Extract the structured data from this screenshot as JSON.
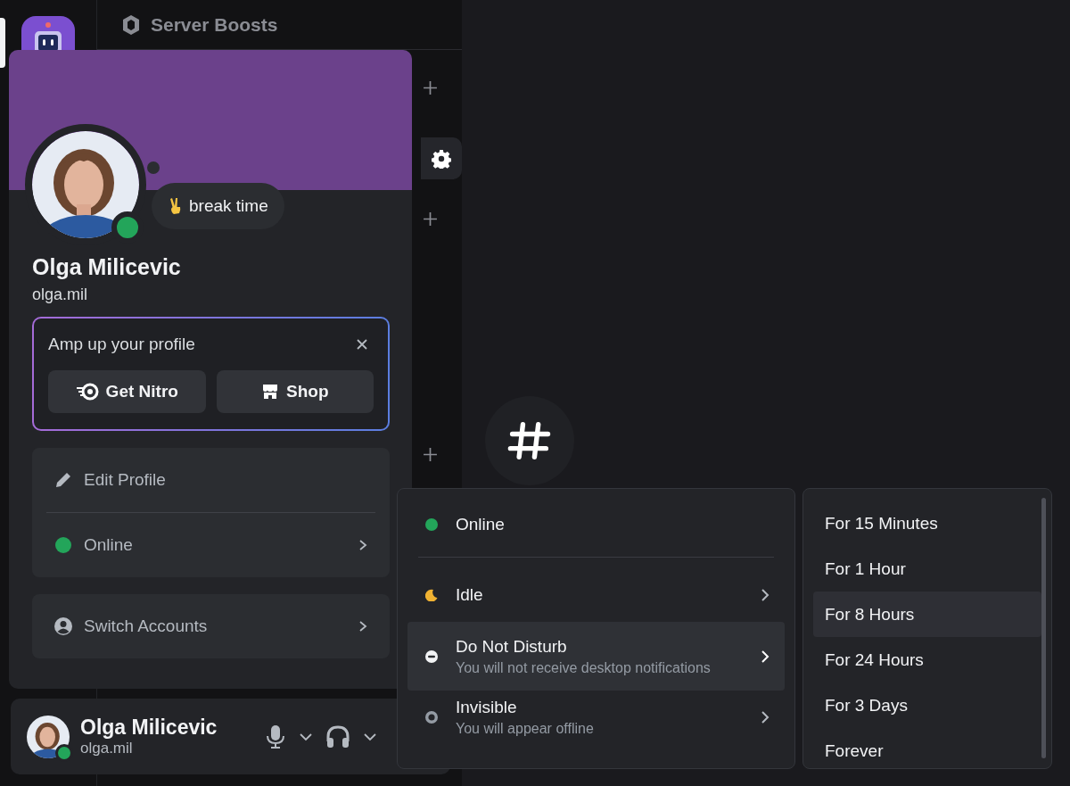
{
  "sidebar": {
    "header": "Server Boosts"
  },
  "profile": {
    "online": true,
    "custom_status": "break time",
    "display_name": "Olga Milicevic",
    "username": "olga.mil",
    "promo": {
      "title": "Amp up your profile",
      "buttons": [
        {
          "label": "Get Nitro",
          "kind": "nitro"
        },
        {
          "label": "Shop",
          "kind": "shop"
        }
      ]
    },
    "actions": [
      {
        "label": "Edit Profile",
        "kind": "edit"
      },
      {
        "label": "Online",
        "kind": "status"
      }
    ],
    "switch_accounts": "Switch Accounts"
  },
  "user_panel": {
    "display_name": "Olga Milicevic",
    "username": "olga.mil",
    "online": true
  },
  "status_menu": [
    {
      "label": "Online",
      "kind": "online",
      "has_submenu": false,
      "selected": false
    },
    {
      "label": "Idle",
      "kind": "idle",
      "has_submenu": true,
      "selected": false
    },
    {
      "label": "Do Not Disturb",
      "kind": "dnd",
      "description": "You will not receive desktop notifications",
      "has_submenu": true,
      "selected": true
    },
    {
      "label": "Invisible",
      "kind": "invisible",
      "description": "You will appear offline",
      "has_submenu": true,
      "selected": false
    }
  ],
  "duration_menu": [
    {
      "label": "For 15 Minutes",
      "selected": false
    },
    {
      "label": "For 1 Hour",
      "selected": false
    },
    {
      "label": "For 8 Hours",
      "selected": true
    },
    {
      "label": "For 24 Hours",
      "selected": false
    },
    {
      "label": "For 3 Days",
      "selected": false
    },
    {
      "label": "Forever",
      "selected": false
    }
  ]
}
